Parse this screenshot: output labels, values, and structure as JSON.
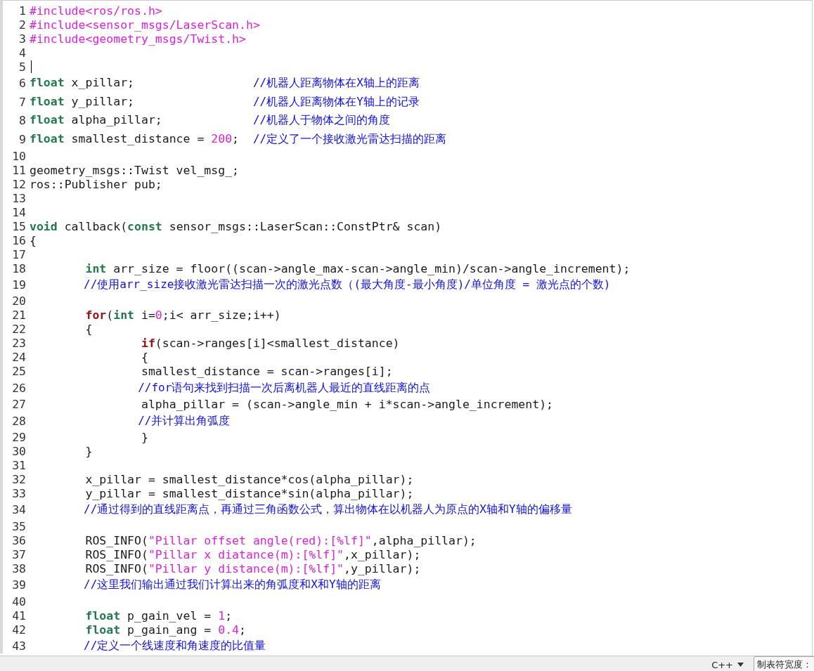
{
  "editor": {
    "lines": [
      {
        "number": "1",
        "tokens": [
          {
            "kind": "preprocessor",
            "text": "#include<ros/ros.h>"
          }
        ]
      },
      {
        "number": "2",
        "tokens": [
          {
            "kind": "preprocessor",
            "text": "#include<sensor_msgs/LaserScan.h>"
          }
        ]
      },
      {
        "number": "3",
        "tokens": [
          {
            "kind": "preprocessor",
            "text": "#include<geometry_msgs/Twist.h>"
          }
        ]
      },
      {
        "number": "4"
      },
      {
        "number": "5",
        "cursor": true
      },
      {
        "number": "6",
        "tokens": [
          {
            "kind": "type",
            "text": "float"
          },
          {
            "kind": "plain",
            "text": " x_pillar;                 "
          },
          {
            "kind": "comment",
            "text": "//机器人距离物体在X轴上的距离"
          }
        ]
      },
      {
        "number": "7",
        "tokens": [
          {
            "kind": "type",
            "text": "float"
          },
          {
            "kind": "plain",
            "text": " y_pillar;                 "
          },
          {
            "kind": "comment",
            "text": "//机器人距离物体在Y轴上的记录"
          }
        ]
      },
      {
        "number": "8",
        "tokens": [
          {
            "kind": "type",
            "text": "float"
          },
          {
            "kind": "plain",
            "text": " alpha_pillar;             "
          },
          {
            "kind": "comment",
            "text": "//机器人于物体之间的角度"
          }
        ]
      },
      {
        "number": "9",
        "tokens": [
          {
            "kind": "type",
            "text": "float"
          },
          {
            "kind": "plain",
            "text": " smallest_distance = "
          },
          {
            "kind": "number",
            "text": "200"
          },
          {
            "kind": "plain",
            "text": ";  "
          },
          {
            "kind": "comment",
            "text": "//定义了一个接收激光雷达扫描的距离"
          }
        ]
      },
      {
        "number": "10"
      },
      {
        "number": "11",
        "tokens": [
          {
            "kind": "plain",
            "text": "geometry_msgs::Twist vel_msg_;"
          }
        ]
      },
      {
        "number": "12",
        "tokens": [
          {
            "kind": "plain",
            "text": "ros::Publisher pub;"
          }
        ]
      },
      {
        "number": "13"
      },
      {
        "number": "14"
      },
      {
        "number": "15",
        "tokens": [
          {
            "kind": "type",
            "text": "void"
          },
          {
            "kind": "plain",
            "text": " callback("
          },
          {
            "kind": "type",
            "text": "const"
          },
          {
            "kind": "plain",
            "text": " sensor_msgs::LaserScan::ConstPtr& scan)"
          }
        ]
      },
      {
        "number": "16",
        "tokens": [
          {
            "kind": "plain",
            "text": "{"
          }
        ]
      },
      {
        "number": "17"
      },
      {
        "number": "18",
        "tokens": [
          {
            "kind": "type",
            "text": "        int"
          },
          {
            "kind": "plain",
            "text": " arr_size = floor((scan->angle_max-scan->angle_min)/scan->angle_increment);"
          }
        ]
      },
      {
        "number": "19",
        "tokens": [
          {
            "kind": "comment",
            "text": "        //使用arr_size接收激光雷达扫描一次的激光点数（(最大角度-最小角度)/单位角度 = 激光点的个数)"
          }
        ]
      },
      {
        "number": "20"
      },
      {
        "number": "21",
        "tokens": [
          {
            "kind": "control",
            "text": "        for"
          },
          {
            "kind": "plain",
            "text": "("
          },
          {
            "kind": "type",
            "text": "int"
          },
          {
            "kind": "plain",
            "text": " i="
          },
          {
            "kind": "number",
            "text": "0"
          },
          {
            "kind": "plain",
            "text": ";i< arr_size;i++)"
          }
        ]
      },
      {
        "number": "22",
        "tokens": [
          {
            "kind": "plain",
            "text": "        {"
          }
        ]
      },
      {
        "number": "23",
        "tokens": [
          {
            "kind": "control",
            "text": "                if"
          },
          {
            "kind": "plain",
            "text": "(scan->ranges[i]<smallest_distance)"
          }
        ]
      },
      {
        "number": "24",
        "tokens": [
          {
            "kind": "plain",
            "text": "                {"
          }
        ]
      },
      {
        "number": "25",
        "tokens": [
          {
            "kind": "plain",
            "text": "                smallest_distance = scan->ranges[i];"
          }
        ]
      },
      {
        "number": "26",
        "tokens": [
          {
            "kind": "comment",
            "text": "                //for语句来找到扫描一次后离机器人最近的直线距离的点"
          }
        ]
      },
      {
        "number": "27",
        "tokens": [
          {
            "kind": "plain",
            "text": "                alpha_pillar = (scan->angle_min + i*scan->angle_increment);"
          }
        ]
      },
      {
        "number": "28",
        "tokens": [
          {
            "kind": "comment",
            "text": "                //并计算出角弧度"
          }
        ]
      },
      {
        "number": "29",
        "tokens": [
          {
            "kind": "plain",
            "text": "                }"
          }
        ]
      },
      {
        "number": "30",
        "tokens": [
          {
            "kind": "plain",
            "text": "        }"
          }
        ]
      },
      {
        "number": "31"
      },
      {
        "number": "32",
        "tokens": [
          {
            "kind": "plain",
            "text": "        x_pillar = smallest_distance*cos(alpha_pillar);"
          }
        ]
      },
      {
        "number": "33",
        "tokens": [
          {
            "kind": "plain",
            "text": "        y_pillar = smallest_distance*sin(alpha_pillar);"
          }
        ]
      },
      {
        "number": "34",
        "tokens": [
          {
            "kind": "comment",
            "text": "        //通过得到的直线距离点，再通过三角函数公式，算出物体在以机器人为原点的X轴和Y轴的偏移量"
          }
        ]
      },
      {
        "number": "35"
      },
      {
        "number": "36",
        "tokens": [
          {
            "kind": "plain",
            "text": "        ROS_INFO("
          },
          {
            "kind": "string",
            "text": "\"Pillar offset angle(red):[%lf]\""
          },
          {
            "kind": "plain",
            "text": ",alpha_pillar);"
          }
        ]
      },
      {
        "number": "37",
        "tokens": [
          {
            "kind": "plain",
            "text": "        ROS_INFO("
          },
          {
            "kind": "string",
            "text": "\"Pillar x diatance(m):[%lf]\""
          },
          {
            "kind": "plain",
            "text": ",x_pillar);"
          }
        ]
      },
      {
        "number": "38",
        "tokens": [
          {
            "kind": "plain",
            "text": "        ROS_INFO("
          },
          {
            "kind": "string",
            "text": "\"Pillar y distance(m):[%lf]\""
          },
          {
            "kind": "plain",
            "text": ",y_pillar);"
          }
        ]
      },
      {
        "number": "39",
        "tokens": [
          {
            "kind": "comment",
            "text": "        //这里我们输出通过我们计算出来的角弧度和X和Y轴的距离"
          }
        ]
      },
      {
        "number": "40"
      },
      {
        "number": "41",
        "tokens": [
          {
            "kind": "type",
            "text": "        float"
          },
          {
            "kind": "plain",
            "text": " p_gain_vel = "
          },
          {
            "kind": "number",
            "text": "1"
          },
          {
            "kind": "plain",
            "text": ";"
          }
        ]
      },
      {
        "number": "42",
        "tokens": [
          {
            "kind": "type",
            "text": "        float"
          },
          {
            "kind": "plain",
            "text": " p_gain_ang = "
          },
          {
            "kind": "number",
            "text": "0.4"
          },
          {
            "kind": "plain",
            "text": ";"
          }
        ]
      },
      {
        "number": "43",
        "tokens": [
          {
            "kind": "comment",
            "text": "        //定义一个线速度和角速度的比值量"
          }
        ]
      }
    ]
  },
  "status_bar": {
    "language": "C++",
    "tab_width_label": "制表符宽度："
  }
}
